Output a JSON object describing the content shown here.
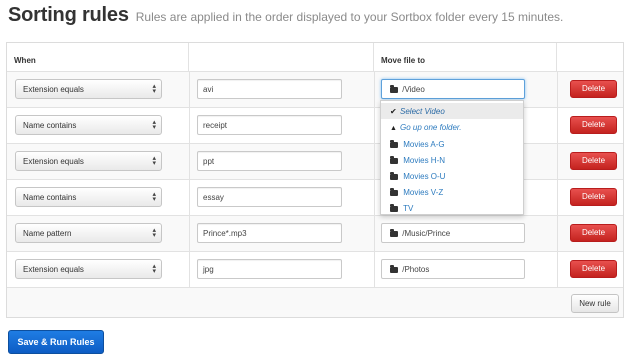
{
  "header": {
    "title": "Sorting rules",
    "subtitle": "Rules are applied in the order displayed to your Sortbox folder every 15 minutes."
  },
  "table": {
    "columns": {
      "when": "When",
      "value": "",
      "move": "Move file to",
      "actions": ""
    },
    "rows": [
      {
        "condition": "Extension equals",
        "value": "avi",
        "folder": "/Video",
        "delete": "Delete"
      },
      {
        "condition": "Name contains",
        "value": "receipt",
        "folder": "",
        "delete": "Delete"
      },
      {
        "condition": "Extension equals",
        "value": "ppt",
        "folder": "",
        "delete": "Delete"
      },
      {
        "condition": "Name contains",
        "value": "essay",
        "folder": "",
        "delete": "Delete"
      },
      {
        "condition": "Name pattern",
        "value": "Prince*.mp3",
        "folder": "/Music/Prince",
        "delete": "Delete"
      },
      {
        "condition": "Extension equals",
        "value": "jpg",
        "folder": "/Photos",
        "delete": "Delete"
      }
    ],
    "new_rule": "New rule"
  },
  "dropdown": {
    "select": "Select Video",
    "up": "Go up one folder.",
    "folders": [
      "Movies A-G",
      "Movies H-N",
      "Movies O-U",
      "Movies V-Z",
      "TV"
    ]
  },
  "actions": {
    "save_run": "Save & Run Rules"
  },
  "colors": {
    "delete": "#d9332f",
    "primary": "#1467d2",
    "link": "#2d7bbf"
  }
}
